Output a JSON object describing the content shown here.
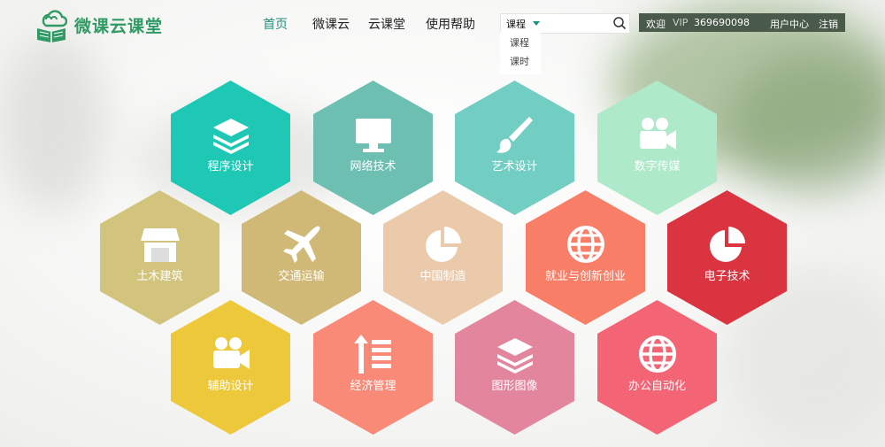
{
  "logo": {
    "text": "微课云课堂",
    "icon": "cloud-book-icon"
  },
  "nav": [
    {
      "label": "首页",
      "active": true
    },
    {
      "label": "微课云",
      "active": false
    },
    {
      "label": "云课堂",
      "active": false
    },
    {
      "label": "使用帮助",
      "active": false
    }
  ],
  "search": {
    "type_value": "课程",
    "options": [
      "课程",
      "课时"
    ],
    "icon": "search-icon"
  },
  "userbar": {
    "welcome": "欢迎",
    "vip": "VIP",
    "user_id": "369690098",
    "user_center": "用户中心",
    "logout": "注销"
  },
  "categories": [
    {
      "label": "程序设计",
      "color": "#1fc8b4",
      "icon": "layers-icon"
    },
    {
      "label": "网络技术",
      "color": "#6cbfb1",
      "icon": "monitor-icon"
    },
    {
      "label": "艺术设计",
      "color": "#72cdc3",
      "icon": "paintbrush-icon"
    },
    {
      "label": "数字传媒",
      "color": "#aee9c9",
      "icon": "video-camera-icon"
    },
    {
      "label": "土木建筑",
      "color": "#d2c47c",
      "icon": "storefront-icon"
    },
    {
      "label": "交通运输",
      "color": "#d0b977",
      "icon": "airplane-icon"
    },
    {
      "label": "中国制造",
      "color": "#ebcaac",
      "icon": "pie-chart-icon"
    },
    {
      "label": "就业与创新创业",
      "color": "#f97e67",
      "icon": "globe-icon"
    },
    {
      "label": "电子技术",
      "color": "#d9343f",
      "icon": "pie-chart-icon"
    },
    {
      "label": "辅助设计",
      "color": "#ecc83a",
      "icon": "video-camera-icon"
    },
    {
      "label": "经济管理",
      "color": "#f98a78",
      "icon": "sort-list-icon"
    },
    {
      "label": "图形图像",
      "color": "#e3859d",
      "icon": "layers-icon"
    },
    {
      "label": "办公自动化",
      "color": "#f36474",
      "icon": "globe-icon"
    }
  ]
}
